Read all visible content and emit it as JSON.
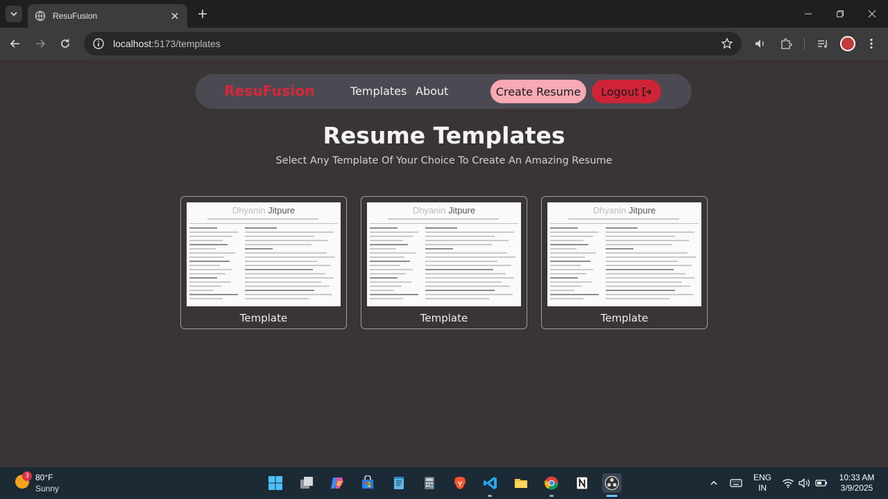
{
  "browser": {
    "tab_title": "ResuFusion",
    "url_host": "localhost",
    "url_rest": ":5173/templates"
  },
  "nav": {
    "brand": "ResuFusion",
    "links": [
      "Templates",
      "About"
    ],
    "create_label": "Create Resume",
    "logout_label": "Logout"
  },
  "main": {
    "title": "Resume Templates",
    "subtitle": "Select Any Template Of Your Choice To Create An Amazing Resume",
    "cards": [
      {
        "label": "Template",
        "name_first": "Dhyanin",
        "name_last": "Jitpure"
      },
      {
        "label": "Template",
        "name_first": "Dhyanin",
        "name_last": "Jitpure"
      },
      {
        "label": "Template",
        "name_first": "Dhyanin",
        "name_last": "Jitpure"
      }
    ]
  },
  "taskbar": {
    "weather_badge": "3",
    "weather_temp": "80°F",
    "weather_cond": "Sunny",
    "lang_top": "ENG",
    "lang_bottom": "IN",
    "time": "10:33 AM",
    "date": "3/9/2025"
  },
  "colors": {
    "brand": "#d9263b",
    "create_button": "#f7a9b4",
    "logout_button": "#cf2438",
    "page_bg": "#3a3436"
  }
}
